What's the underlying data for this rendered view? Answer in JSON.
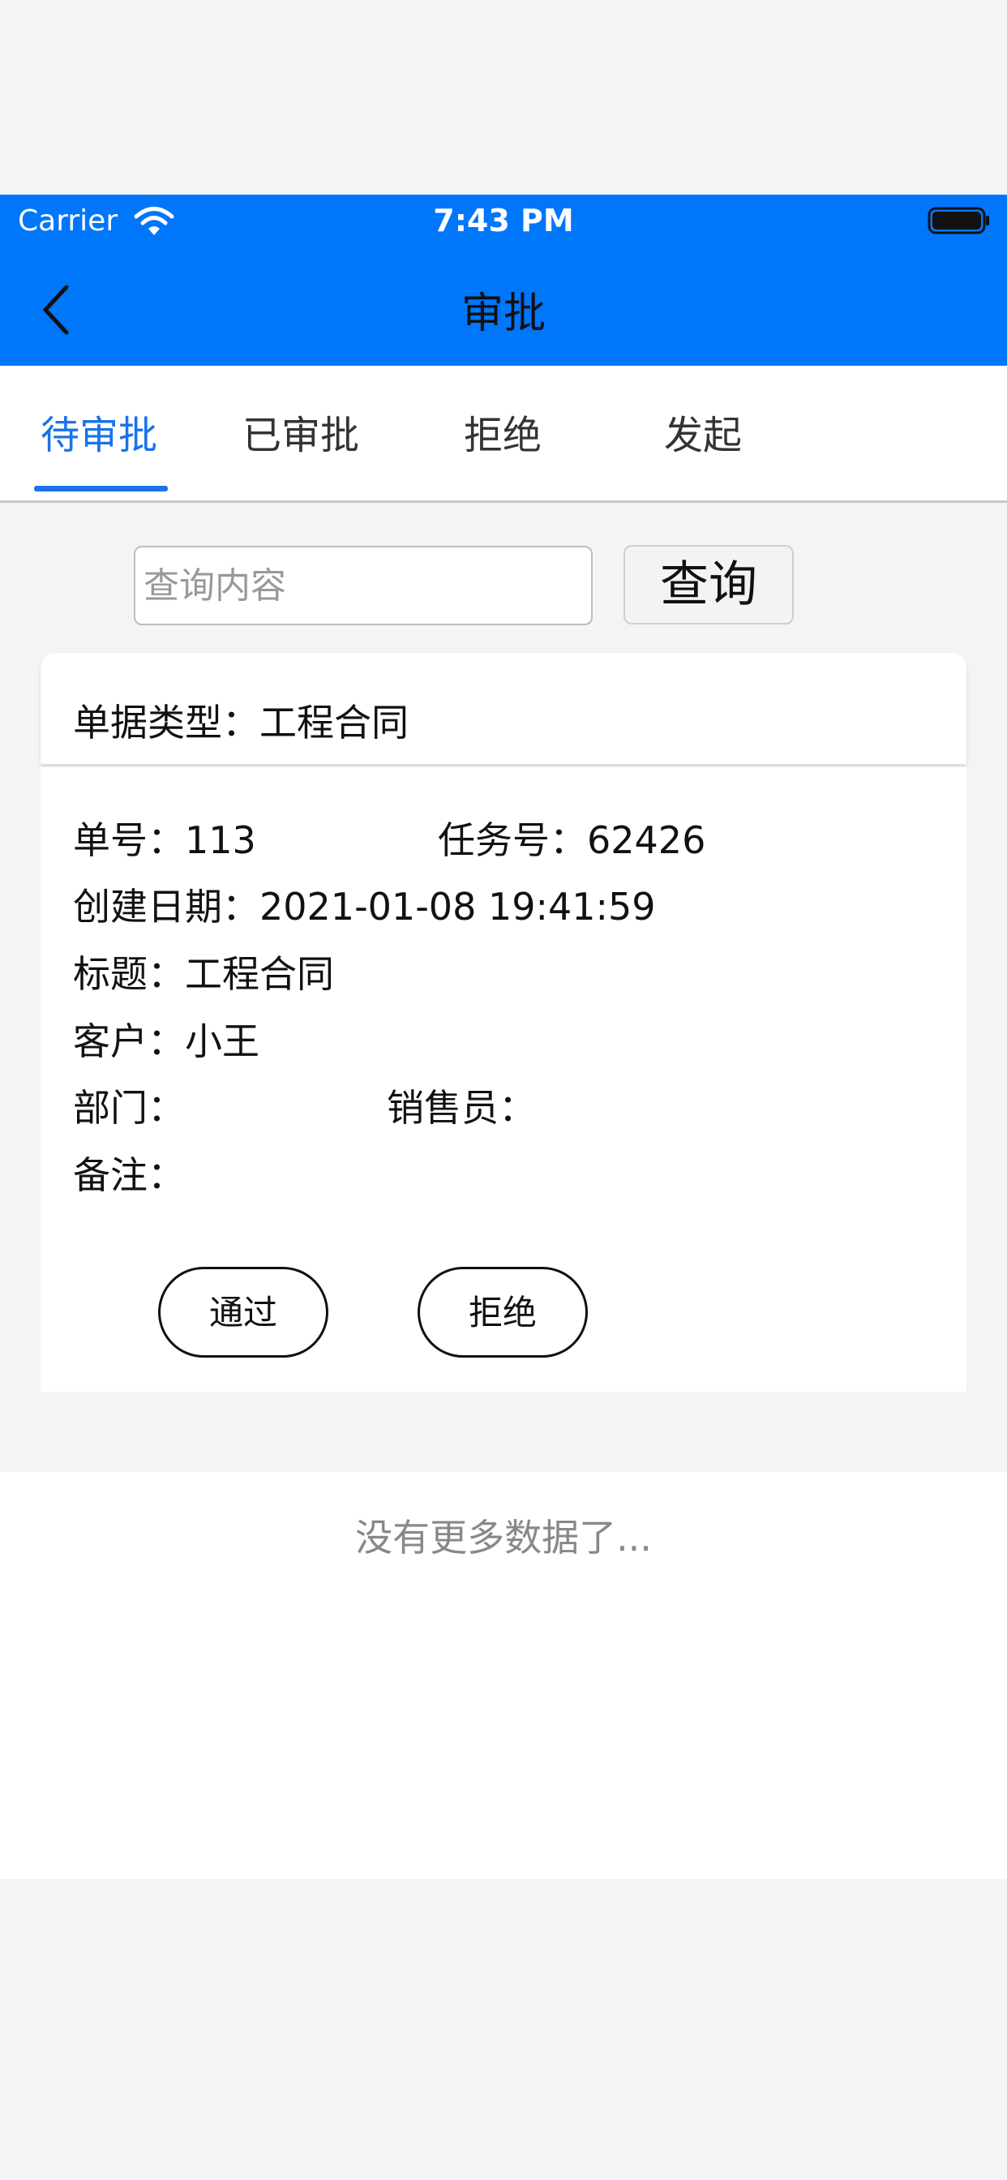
{
  "status_bar": {
    "carrier": "Carrier",
    "time": "7:43 PM"
  },
  "nav": {
    "title": "审批",
    "back_icon": "chevron-left-icon"
  },
  "tabs": [
    {
      "label": "待审批",
      "active": true
    },
    {
      "label": "已审批",
      "active": false
    },
    {
      "label": "拒绝",
      "active": false
    },
    {
      "label": "发起",
      "active": false
    }
  ],
  "search": {
    "placeholder": "查询内容",
    "value": "",
    "button_label": "查询"
  },
  "card": {
    "doc_type": "单据类型：工程合同",
    "order_no": "单号：113",
    "task_no": "任务号：62426",
    "created": "创建日期：2021-01-08 19:41:59",
    "title": "标题：工程合同",
    "customer": "客户：小王",
    "department": "部门：",
    "salesperson": "销售员：",
    "remark": "备注：",
    "approve_label": "通过",
    "reject_label": "拒绝"
  },
  "footer": {
    "no_more": "没有更多数据了..."
  },
  "colors": {
    "accent": "#0076fb",
    "tab_active": "#1a73e8"
  }
}
